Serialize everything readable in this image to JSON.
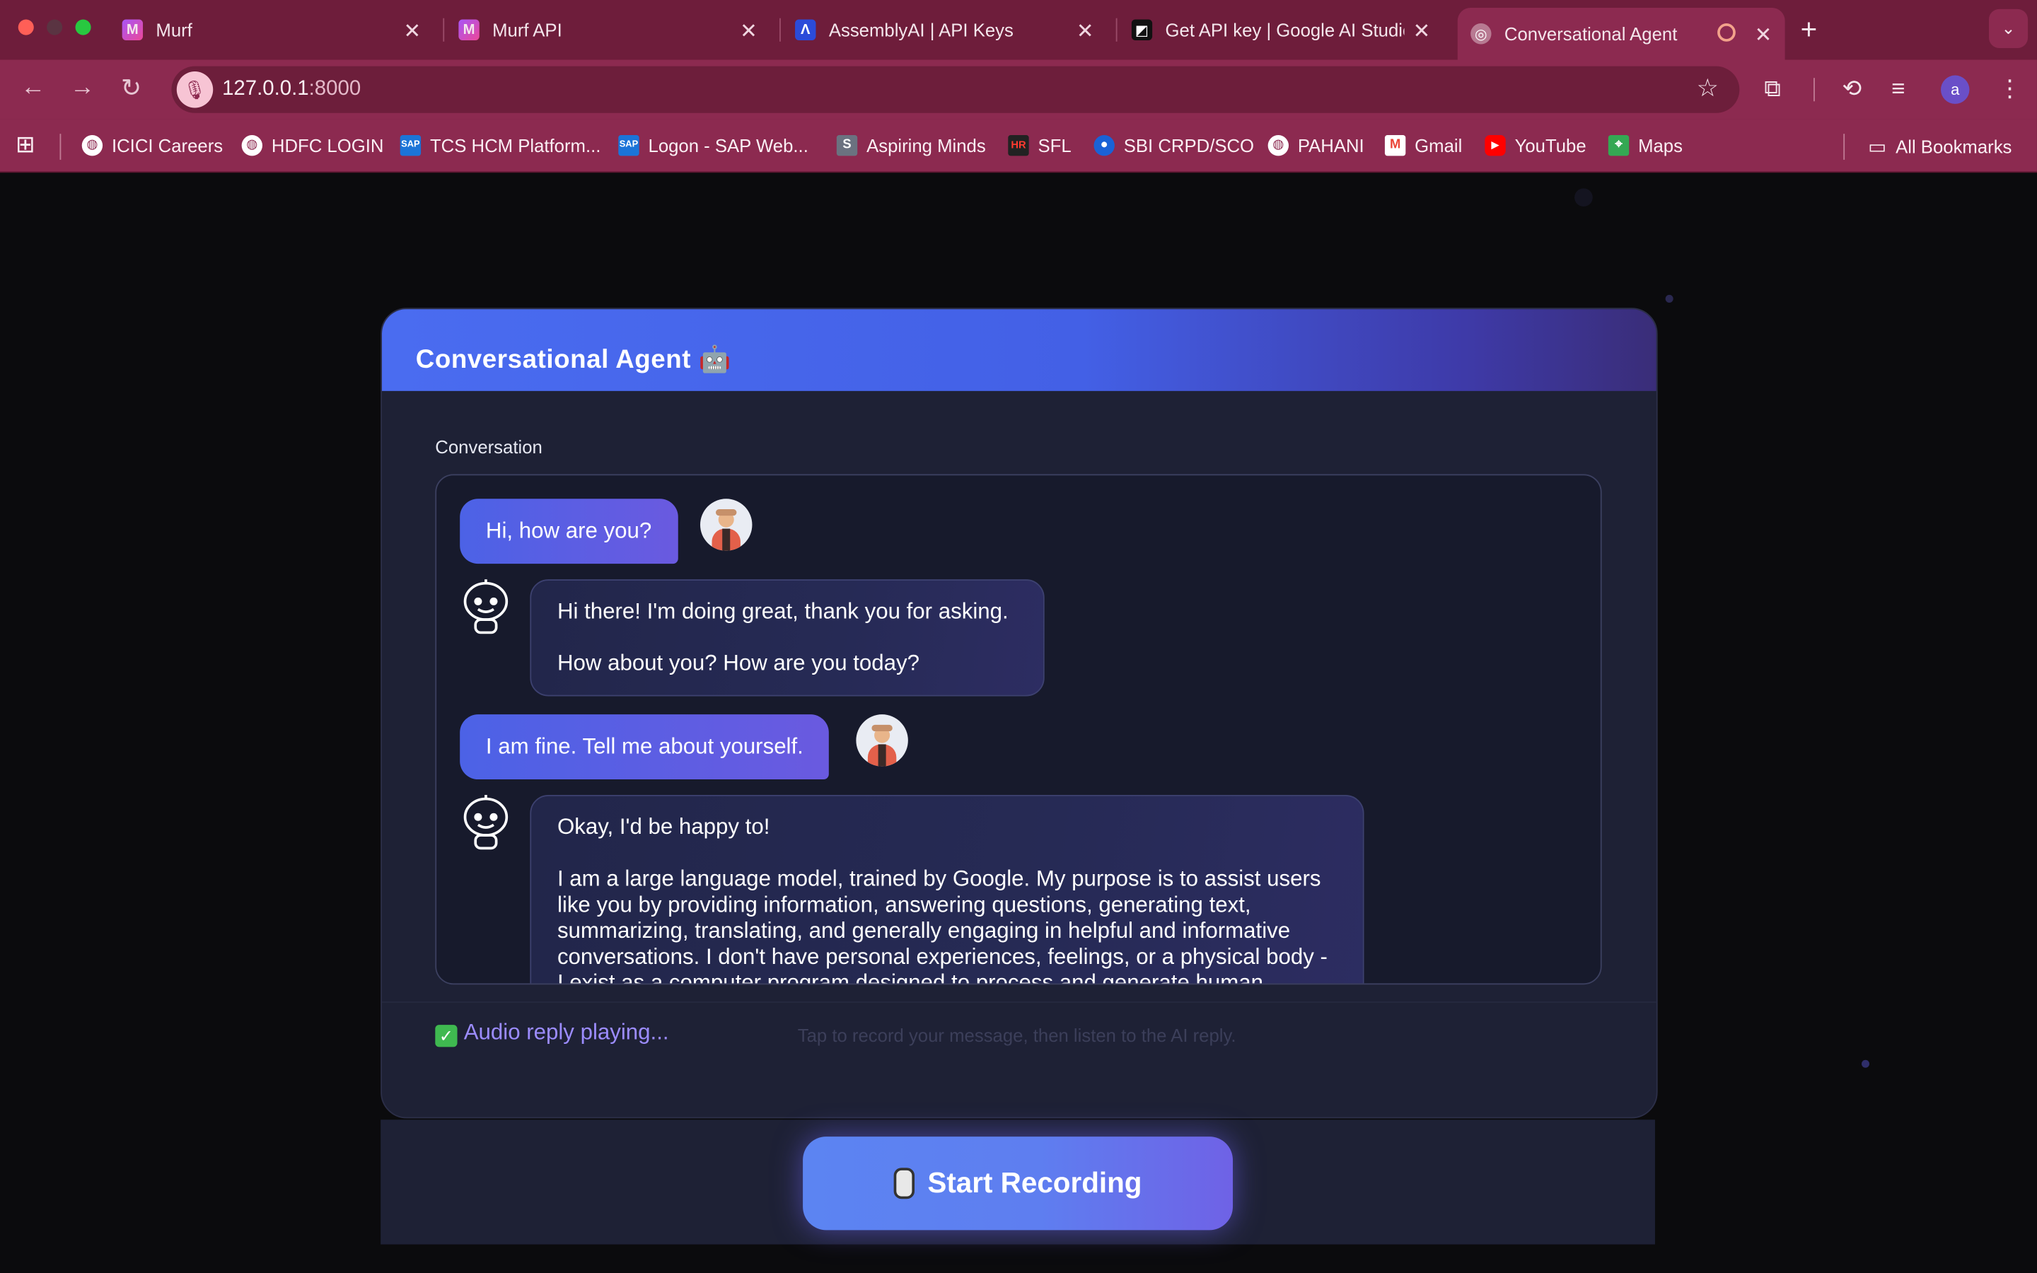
{
  "browser": {
    "tabs": [
      {
        "title": "Murf",
        "favicon": "murf-logo",
        "active": false
      },
      {
        "title": "Murf API",
        "favicon": "murf-logo",
        "active": false
      },
      {
        "title": "AssemblyAI | API Keys",
        "favicon": "assemblyai-logo",
        "active": false
      },
      {
        "title": "Get API key | Google AI Studio",
        "favicon": "google-ai-studio-logo",
        "active": false
      },
      {
        "title": "Conversational Agent",
        "favicon": "globe-icon",
        "active": true
      }
    ],
    "url_host": "127.0.0.1",
    "url_port": ":8000",
    "profile_initial": "a"
  },
  "bookmarks": {
    "items": [
      {
        "label": "ICICI Careers",
        "icon": "globe-icon"
      },
      {
        "label": "HDFC LOGIN",
        "icon": "globe-icon"
      },
      {
        "label": "TCS HCM Platform...",
        "icon": "sap-logo"
      },
      {
        "label": "Logon - SAP Web...",
        "icon": "sap-logo"
      },
      {
        "label": "Aspiring Minds",
        "icon": "aspiring-minds-logo"
      },
      {
        "label": "SFL",
        "icon": "sfl-logo"
      },
      {
        "label": "SBI CRPD/SCO",
        "icon": "sbi-logo"
      },
      {
        "label": "PAHANI",
        "icon": "globe-icon"
      },
      {
        "label": "Gmail",
        "icon": "gmail-logo"
      },
      {
        "label": "YouTube",
        "icon": "youtube-logo"
      },
      {
        "label": "Maps",
        "icon": "maps-logo"
      }
    ],
    "all_bookmarks": "All Bookmarks"
  },
  "app": {
    "title": "Conversational Agent 🤖",
    "conversation_label": "Conversation",
    "messages": [
      {
        "role": "user",
        "text": "Hi, how are you?"
      },
      {
        "role": "bot",
        "text": "Hi there! I'm doing great, thank you for asking.\n\nHow about you? How are you today?"
      },
      {
        "role": "user",
        "text": "I am fine. Tell me about yourself."
      },
      {
        "role": "bot",
        "text": "Okay, I'd be happy to!\n\nI am a large language model, trained by Google. My purpose is to assist users like you by providing information, answering questions, generating text, summarizing, translating, and generally engaging in helpful and informative conversations. I don't have personal experiences, feelings, or a physical body - I exist as a computer program designed to process and generate human"
      }
    ],
    "status_text": "Audio reply playing...",
    "hint_text": "Tap to record your message, then listen to the AI reply.",
    "record_button": "Start Recording"
  },
  "colors": {
    "browser_frame": "#8c2a50",
    "header_gradient_start": "#4a6cf0",
    "accent_status": "#9c8cff",
    "record_button": "#5c84f2"
  }
}
